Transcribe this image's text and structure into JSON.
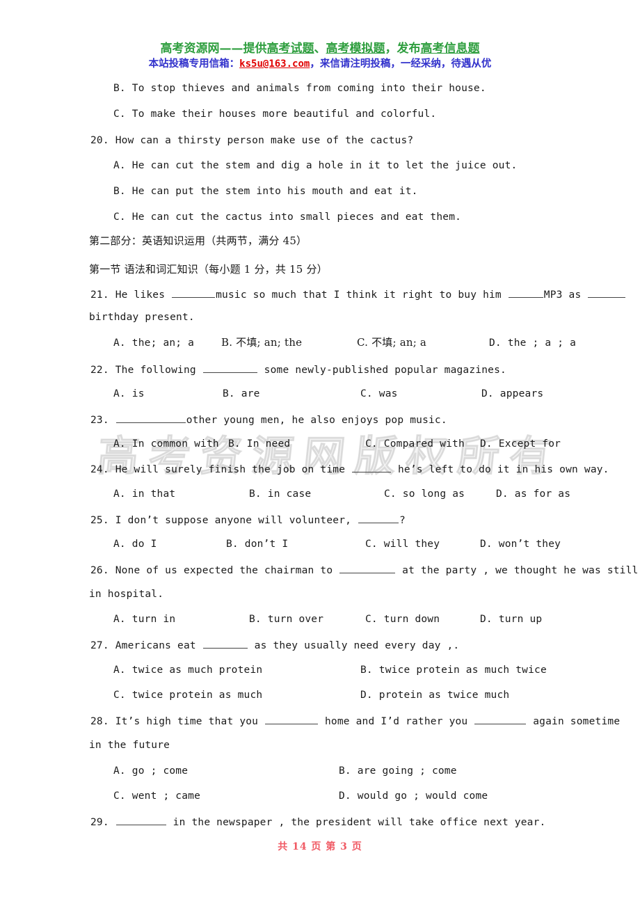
{
  "header": {
    "line1_part1": "高考资源网——提供",
    "line1_u1": "高考试题",
    "line1_mid1": "、",
    "line1_u2": "高考模拟题",
    "line1_mid2": "，发布",
    "line1_u3": "高考信息题",
    "line2_prefix": "本站投稿专用信箱：",
    "line2_email": "ks5u@163.com",
    "line2_suffix": "，来信请注明投稿，一经采纳，待遇从优",
    "green": "#2e9e3e",
    "blue": "#3333cc",
    "red": "#e00000"
  },
  "watermark": {
    "text": "高考资源网版权所有"
  },
  "footer": {
    "text": "共 14 页 第 3 页",
    "color": "#f05a64"
  },
  "lines": {
    "q19_b": "B. To stop thieves and animals from coming into their house.",
    "q19_c": "C. To make their houses more beautiful and colorful.",
    "q20_stem": "20. How can a thirsty person make use of the cactus?",
    "q20_a": "A. He can cut the stem and dig a hole in it to let the juice out.",
    "q20_b": "B. He can put the stem into his mouth and eat it.",
    "q20_c": "C. He can cut the cactus into small pieces and eat them.",
    "part2_title": "第二部分：英语知识运用（共两节，满分 45）",
    "section1_title": "第一节 语法和词汇知识（每小题 1 分，共 15 分）",
    "q21_s1": "21. He likes ",
    "q21_s2": "music so much that I think it right to buy him ",
    "q21_s3": "MP3 as ",
    "q21_line2": "birthday present.",
    "q21_a": "A. the; an; a",
    "q21_b": "B. 不填; an; the",
    "q21_c": "C. 不填; an; a",
    "q21_d": "D. the ; a ; a",
    "q22_s1": "22. The following ",
    "q22_s2": " some newly-published popular magazines.",
    "q22_a": "A. is",
    "q22_b": "B. are",
    "q22_c": "C. was",
    "q22_d": "D.  appears",
    "q23_s1": "23. ",
    "q23_s2": "other young men, he also enjoys pop music.",
    "q23_a": "A. In common with",
    "q23_b": "B. In need",
    "q23_c": "C. Compared with",
    "q23_d": "D. Except for",
    "q24_s1": "24. He will surely finish the job on time ",
    "q24_s2": " he’s left to do it in his own way.",
    "q24_a": "A. in that",
    "q24_b": "B. in case",
    "q24_c": "C. so long as",
    "q24_d": "D. as for as",
    "q25_s1": "25. I don’t suppose anyone will volunteer, ",
    "q25_s2": "?",
    "q25_a": "A. do I",
    "q25_b": "B. don’t I",
    "q25_c": "C. will they",
    "q25_d": "D. won’t they",
    "q26_s1": "26. None of us expected the chairman to ",
    "q26_s2": " at the party , we thought he was still",
    "q26_line2": "in hospital.",
    "q26_a": "A. turn in",
    "q26_b": "B. turn over",
    "q26_c": "C. turn down",
    "q26_d": "D. turn up",
    "q27_s1": "27. Americans eat ",
    "q27_s2": " as they usually need every day ,.",
    "q27_a": "A. twice as much protein",
    "q27_b": "B. twice protein as  much twice",
    "q27_c": "C. twice protein as much",
    "q27_d": "D. protein as twice much",
    "q28_s1": "28. It’s high time that you ",
    "q28_s2": " home and I’d rather you ",
    "q28_s3": " again sometime",
    "q28_line2": "in the future",
    "q28_a": "A. go ; come",
    "q28_b": "B. are going ; come",
    "q28_c": "C. went ; came",
    "q28_d": "D. would go ; would come",
    "q29_s1": "29. ",
    "q29_s2": " in the newspaper , the president will take office next year."
  }
}
